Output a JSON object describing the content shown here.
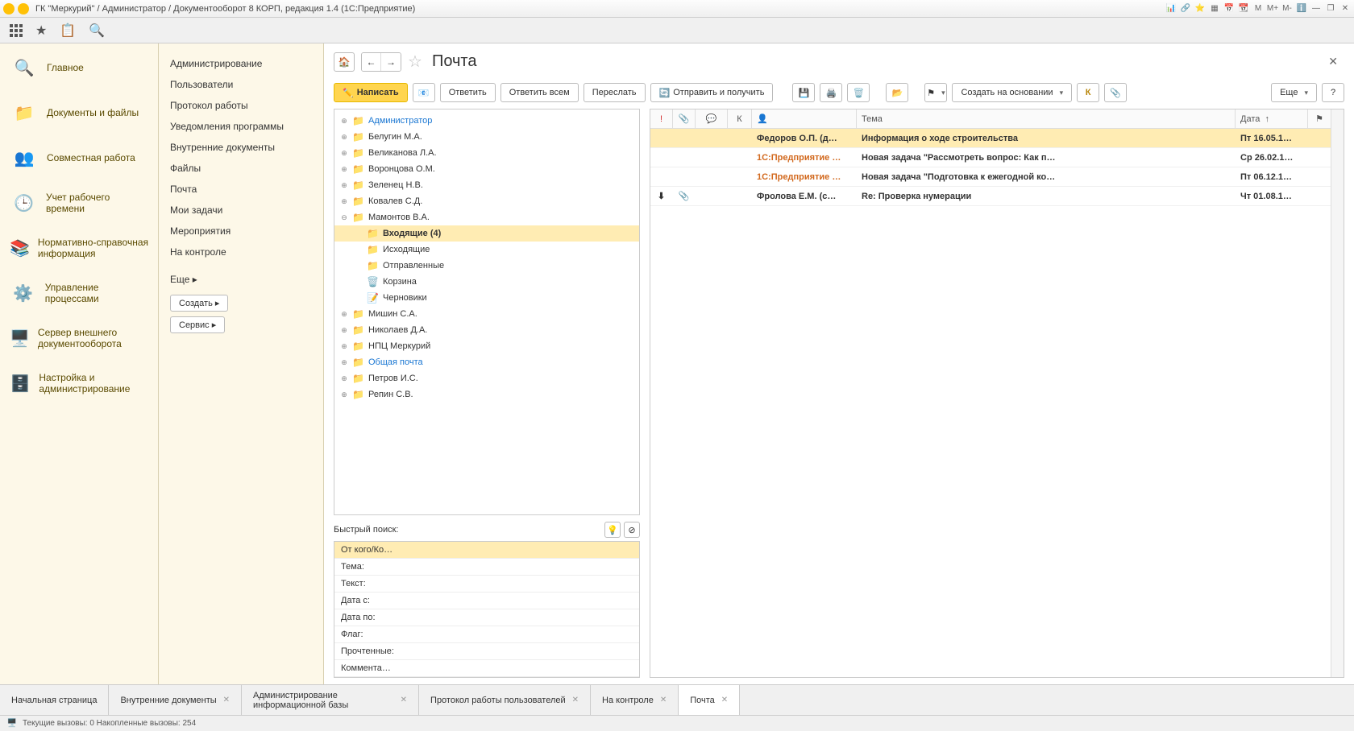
{
  "titlebar": {
    "text": "ГК \"Меркурий\" / Администратор / Документооборот 8 КОРП, редакция 1.4  (1С:Предприятие)",
    "mbuttons": [
      "M",
      "M+",
      "M-"
    ]
  },
  "leftnav": [
    {
      "label": "Главное",
      "icon": "🔍"
    },
    {
      "label": "Документы и файлы",
      "icon": "📁"
    },
    {
      "label": "Совместная работа",
      "icon": "👥"
    },
    {
      "label": "Учет рабочего времени",
      "icon": "🕒"
    },
    {
      "label": "Нормативно-справочная информация",
      "icon": "📚"
    },
    {
      "label": "Управление процессами",
      "icon": "⚙️"
    },
    {
      "label": "Сервер внешнего документооборота",
      "icon": "🖥️"
    },
    {
      "label": "Настройка и администрирование",
      "icon": "🗄️"
    }
  ],
  "subnav": {
    "links": [
      "Администрирование",
      "Пользователи",
      "Протокол работы",
      "Уведомления программы",
      "Внутренние документы",
      "Файлы",
      "Почта",
      "Мои задачи",
      "Мероприятия",
      "На контроле"
    ],
    "more": "Еще ▸",
    "btn_create": "Создать ▸",
    "btn_service": "Сервис ▸"
  },
  "header": {
    "title": "Почта"
  },
  "actions": {
    "compose": "Написать",
    "reply": "Ответить",
    "reply_all": "Ответить всем",
    "forward": "Переслать",
    "send_recv": "Отправить и получить",
    "create_based": "Создать на основании",
    "more": "Еще",
    "k_label": "К"
  },
  "tree": [
    {
      "label": "Администратор",
      "link": true,
      "exp": "⊕"
    },
    {
      "label": "Белугин М.А.",
      "exp": "⊕"
    },
    {
      "label": "Великанова Л.А.",
      "exp": "⊕"
    },
    {
      "label": "Воронцова О.М.",
      "exp": "⊕"
    },
    {
      "label": "Зеленец Н.В.",
      "exp": "⊕"
    },
    {
      "label": "Ковалев С.Д.",
      "exp": "⊕"
    },
    {
      "label": "Мамонтов В.А.",
      "exp": "⊖",
      "expanded": true,
      "children": [
        {
          "label": "Входящие (4)",
          "selected": true,
          "icon": "📁"
        },
        {
          "label": "Исходящие",
          "icon": "📁"
        },
        {
          "label": "Отправленные",
          "icon": "📁"
        },
        {
          "label": "Корзина",
          "icon": "🗑️"
        },
        {
          "label": "Черновики",
          "icon": "📝"
        }
      ]
    },
    {
      "label": "Мишин С.А.",
      "exp": "⊕"
    },
    {
      "label": "Николаев Д.А.",
      "exp": "⊕"
    },
    {
      "label": "НПЦ Меркурий",
      "exp": "⊕"
    },
    {
      "label": "Общая почта",
      "link": true,
      "exp": "⊕"
    },
    {
      "label": "Петров И.С.",
      "exp": "⊕"
    },
    {
      "label": "Репин С.В.",
      "exp": "⊕"
    }
  ],
  "quick_search": {
    "label": "Быстрый поиск:",
    "rows": [
      "От кого/Ко…",
      "Тема:",
      "Текст:",
      "Дата с:",
      "Дата по:",
      "Флаг:",
      "Прочтенные:",
      "Коммента…"
    ]
  },
  "mail_cols": {
    "k": "К",
    "subject": "Тема",
    "date": "Дата"
  },
  "mail_rows": [
    {
      "from": "Федоров О.П. (д…",
      "subject": "Информация о ходе строительства",
      "date": "Пт 16.05.1…",
      "bold": true,
      "selected": true
    },
    {
      "from": "1С:Предприятие …",
      "subject": "Новая задача \"Рассмотреть вопрос: Как п…",
      "date": "Ср 26.02.1…",
      "bold": true,
      "orange": true
    },
    {
      "from": "1С:Предприятие …",
      "subject": "Новая задача \"Подготовка к ежегодной ко…",
      "date": "Пт 06.12.1…",
      "bold": true,
      "orange": true
    },
    {
      "from": "Фролова Е.М. (с…",
      "subject": "Re: Проверка нумерации",
      "date": "Чт 01.08.1…",
      "bold": true,
      "attach": "📎",
      "down": "⬇"
    }
  ],
  "bottom_tabs": [
    {
      "label": "Начальная страница",
      "closable": false
    },
    {
      "label": "Внутренние документы",
      "closable": true
    },
    {
      "label": "Администрирование информационной базы",
      "closable": true
    },
    {
      "label": "Протокол работы пользователей",
      "closable": true
    },
    {
      "label": "На контроле",
      "closable": true
    },
    {
      "label": "Почта",
      "closable": true,
      "active": true
    }
  ],
  "status": "Текущие вызовы: 0  Накопленные вызовы: 254"
}
